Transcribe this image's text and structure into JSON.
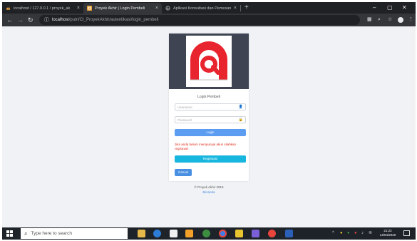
{
  "browser": {
    "tabs": [
      {
        "label": "localhost / 127.0.0.1 / proyek_ak",
        "favicon": "phpmyadmin-icon",
        "active": false
      },
      {
        "label": "Proyek Akhir | Login Pembeli",
        "favicon": "page-logo-icon",
        "active": true
      },
      {
        "label": "Aplikasi Konsultasi dan Pemesan",
        "favicon": "globe-icon",
        "active": false
      }
    ],
    "new_tab": "+",
    "url_host": "localhost",
    "url_path": "/putri/CI_ProyekAkhir/autentikasi/login_pembeli"
  },
  "login": {
    "title": "Login Pembeli",
    "username_placeholder": "Username",
    "password_placeholder": "Password",
    "login_button": "Login",
    "register_prompt": "Jika anda belum mempunyai akun silahkan registrasi!",
    "register_button": "Registrasi",
    "cancel_button": "Cancel"
  },
  "footer": {
    "copyright": "© Proyek Akhir 2019",
    "link": "Beranda"
  },
  "taskbar": {
    "search_placeholder": "Type here to search",
    "time": "21:22",
    "date": "14/04/2020"
  },
  "colors": {
    "hero_bg": "#3f4453",
    "primary_button": "#5c9df2",
    "register_button": "#17b6de",
    "cancel_button": "#4a90e2",
    "note_text": "#e02d1b",
    "logo_red": "#e8242e"
  }
}
